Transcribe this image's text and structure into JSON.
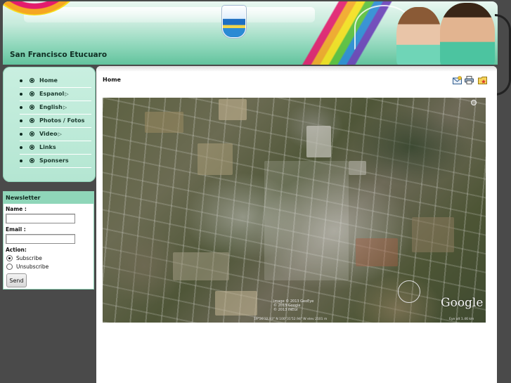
{
  "site": {
    "title": "San Francisco Etucuaro"
  },
  "nav": {
    "items": [
      {
        "label": "Home",
        "arrow": ""
      },
      {
        "label": "Espanol",
        "arrow": "▷"
      },
      {
        "label": "English",
        "arrow": "▷"
      },
      {
        "label": "Photos / Fotos",
        "arrow": ""
      },
      {
        "label": "Video",
        "arrow": "▷"
      },
      {
        "label": "Links",
        "arrow": ""
      },
      {
        "label": "Sponsers",
        "arrow": ""
      }
    ]
  },
  "newsletter": {
    "title": "Newsletter",
    "name_label": "Name :",
    "name_value": "",
    "email_label": "Email :",
    "email_value": "",
    "action_label": "Action:",
    "subscribe_label": "Subscribe",
    "unsubscribe_label": "Unsubscribe",
    "send_label": "Send",
    "selected_action": "Subscribe"
  },
  "main": {
    "page_title": "Home",
    "tools": [
      "email-icon",
      "print-icon",
      "favorite-icon"
    ],
    "map": {
      "copyright": "Image © 2013 GeoEye\n© 2013 Google\n© 2013 INEGI",
      "coords": "19°26'32.93\" N   100°31'52.94\" W   elev 2101 m",
      "eye_alt": "Eye alt 1.46 km",
      "brand": "Google"
    }
  },
  "colors": {
    "accent": "#8fd6b9",
    "nav_bg": "#c9efe0",
    "page_bg": "#4a4a4a"
  }
}
